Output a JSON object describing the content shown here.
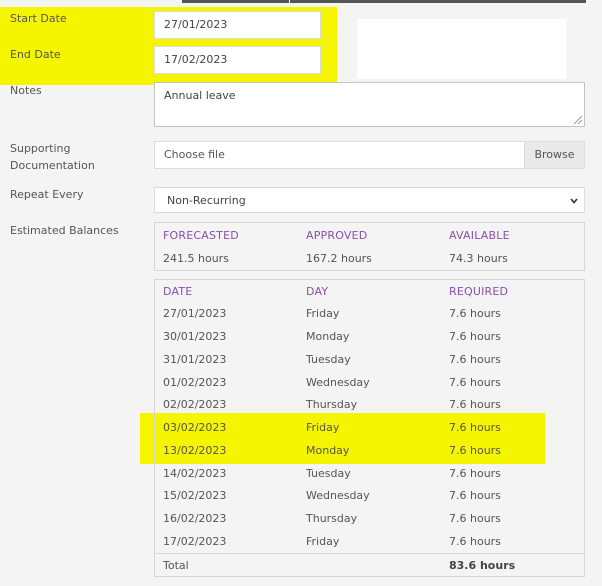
{
  "form": {
    "start_date": {
      "label": "Start Date",
      "value": "27/01/2023"
    },
    "end_date": {
      "label": "End Date",
      "value": "17/02/2023"
    },
    "notes": {
      "label": "Notes",
      "value": "Annual leave"
    },
    "supporting_documentation": {
      "label_line1": "Supporting",
      "label_line2": "Documentation",
      "file_text": "Choose file",
      "browse_label": "Browse"
    },
    "repeat_every": {
      "label": "Repeat Every",
      "selected": "Non-Recurring",
      "chevron_icon": "chevron-down-icon"
    },
    "estimated_balances_label": "Estimated Balances"
  },
  "balances": {
    "headers": [
      "FORECASTED",
      "APPROVED",
      "AVAILABLE"
    ],
    "values": [
      "241.5 hours",
      "167.2 hours",
      "74.3 hours"
    ]
  },
  "schedule": {
    "headers": [
      "DATE",
      "DAY",
      "REQUIRED"
    ],
    "rows": [
      [
        "27/01/2023",
        "Friday",
        "7.6 hours"
      ],
      [
        "30/01/2023",
        "Monday",
        "7.6 hours"
      ],
      [
        "31/01/2023",
        "Tuesday",
        "7.6 hours"
      ],
      [
        "01/02/2023",
        "Wednesday",
        "7.6 hours"
      ],
      [
        "02/02/2023",
        "Thursday",
        "7.6 hours"
      ],
      [
        "03/02/2023",
        "Friday",
        "7.6 hours"
      ],
      [
        "13/02/2023",
        "Monday",
        "7.6 hours"
      ],
      [
        "14/02/2023",
        "Tuesday",
        "7.6 hours"
      ],
      [
        "15/02/2023",
        "Wednesday",
        "7.6 hours"
      ],
      [
        "16/02/2023",
        "Thursday",
        "7.6 hours"
      ],
      [
        "17/02/2023",
        "Friday",
        "7.6 hours"
      ]
    ],
    "total_label": "Total",
    "total_value": "83.6 hours"
  },
  "colors": {
    "highlight": "#f5f500",
    "header_purple": "#8a4fa8"
  }
}
